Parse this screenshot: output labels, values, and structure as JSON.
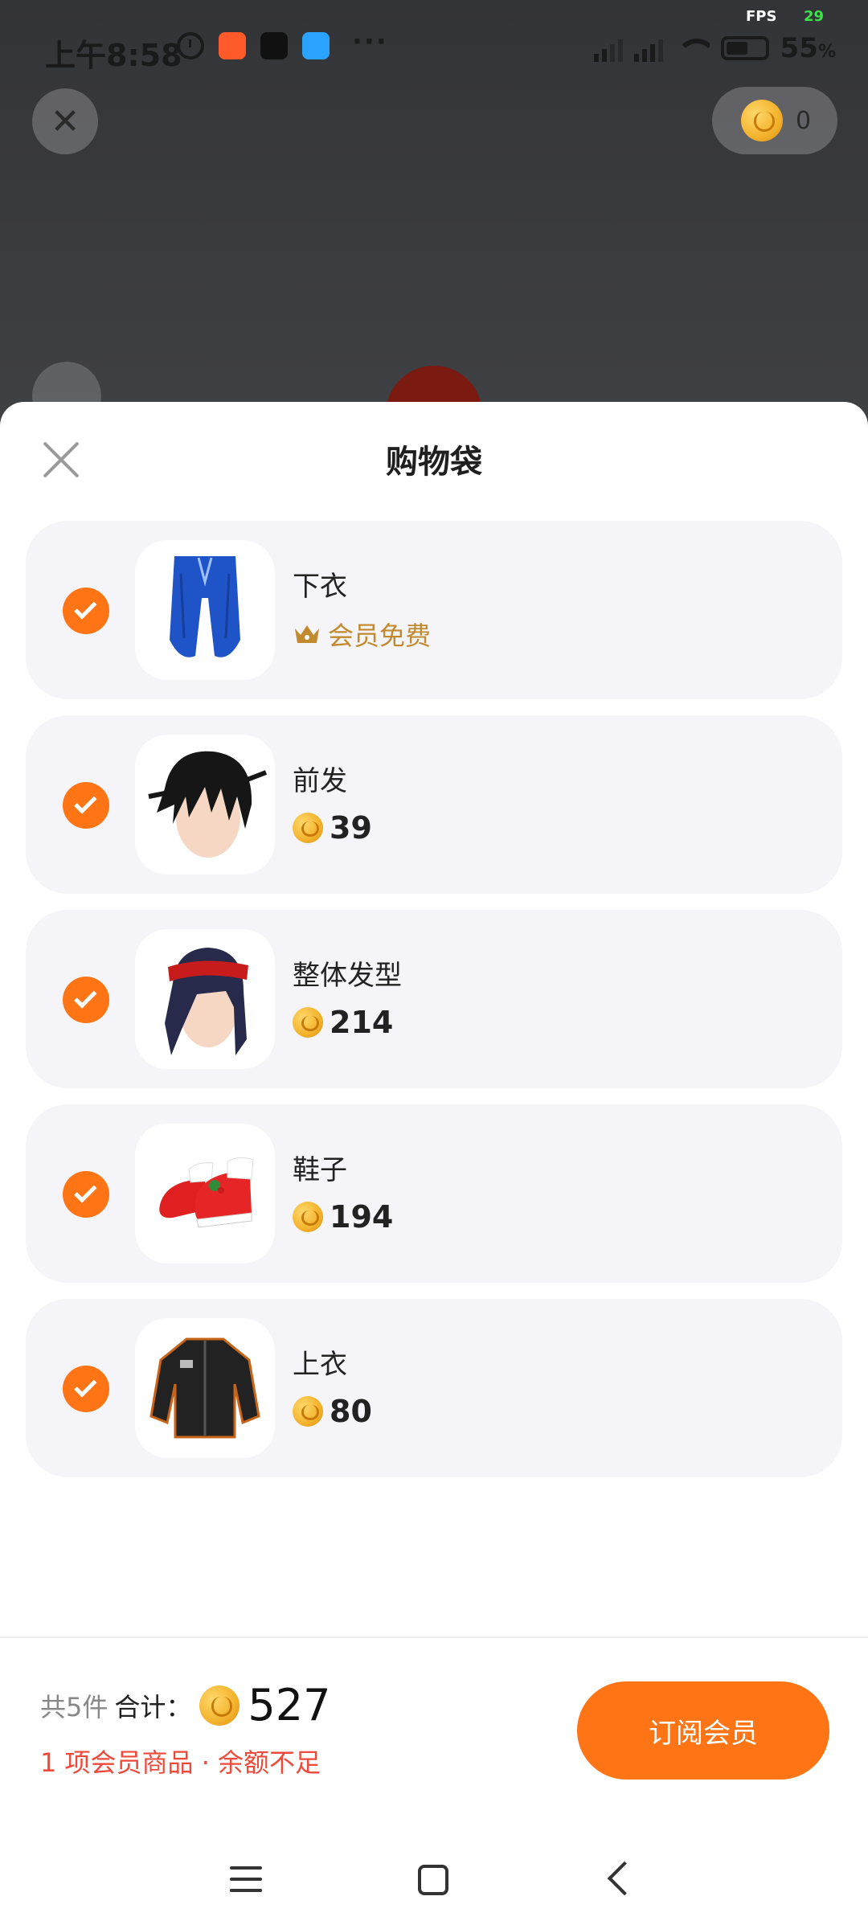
{
  "status_bar": {
    "time": "上午8:58",
    "more": "···",
    "fps_label": "FPS",
    "fps_value": "29",
    "battery": "55",
    "battery_unit": "%"
  },
  "background": {
    "coin_balance": "0"
  },
  "sheet": {
    "title": "购物袋",
    "items": [
      {
        "name": "下衣",
        "price_type": "vip",
        "vip_label": "会员免费",
        "selected": true
      },
      {
        "name": "前发",
        "price_type": "coin",
        "price": "39",
        "selected": true
      },
      {
        "name": "整体发型",
        "price_type": "coin",
        "price": "214",
        "selected": true
      },
      {
        "name": "鞋子",
        "price_type": "coin",
        "price": "194",
        "selected": true
      },
      {
        "name": "上衣",
        "price_type": "coin",
        "price": "80",
        "selected": true
      }
    ]
  },
  "footer": {
    "count_label": "共5件",
    "total_label": "合计：",
    "total_value": "527",
    "warning": "1 项会员商品 · 余额不足",
    "subscribe_label": "订阅会员"
  },
  "colors": {
    "accent": "#ff7414",
    "vip_gold": "#c28a2e",
    "warning_red": "#ee4a3c",
    "item_bg": "#f5f5f9"
  },
  "icons": {
    "close": "close-icon",
    "check": "check-icon",
    "coin": "coin-icon",
    "crown": "crown-icon"
  }
}
